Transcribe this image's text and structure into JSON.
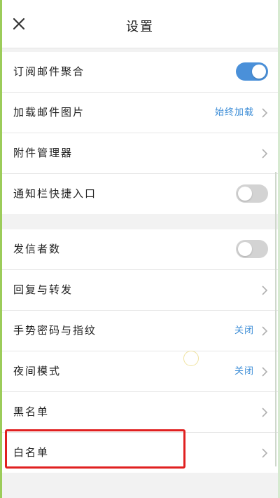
{
  "header": {
    "title": "设置",
    "close_icon": "close-icon"
  },
  "group1": {
    "rows": [
      {
        "label": "订阅邮件聚合",
        "control": "toggle",
        "toggle_on": true
      },
      {
        "label": "加载邮件图片",
        "control": "value-chevron",
        "value": "始终加载"
      },
      {
        "label": "附件管理器",
        "control": "chevron"
      },
      {
        "label": "通知栏快捷入口",
        "control": "toggle",
        "toggle_on": false
      }
    ]
  },
  "group2": {
    "rows": [
      {
        "label": "发信者数",
        "control": "toggle",
        "toggle_on": false
      },
      {
        "label": "回复与转发",
        "control": "chevron"
      },
      {
        "label": "手势密码与指纹",
        "control": "value-chevron",
        "value": "关闭"
      },
      {
        "label": "夜间模式",
        "control": "value-chevron",
        "value": "关闭"
      },
      {
        "label": "黑名单",
        "control": "chevron"
      },
      {
        "label": "白名单",
        "control": "chevron",
        "highlighted": true
      }
    ]
  },
  "colors": {
    "accent": "#4a90d9",
    "value_text": "#3e8ed7",
    "highlight": "#e02020"
  }
}
